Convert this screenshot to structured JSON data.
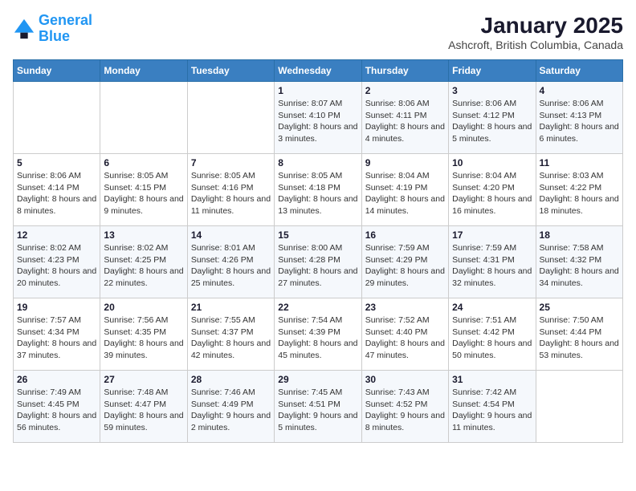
{
  "logo": {
    "line1": "General",
    "line2": "Blue"
  },
  "title": "January 2025",
  "subtitle": "Ashcroft, British Columbia, Canada",
  "days_of_week": [
    "Sunday",
    "Monday",
    "Tuesday",
    "Wednesday",
    "Thursday",
    "Friday",
    "Saturday"
  ],
  "weeks": [
    [
      {
        "num": "",
        "detail": ""
      },
      {
        "num": "",
        "detail": ""
      },
      {
        "num": "",
        "detail": ""
      },
      {
        "num": "1",
        "detail": "Sunrise: 8:07 AM\nSunset: 4:10 PM\nDaylight: 8 hours and 3 minutes."
      },
      {
        "num": "2",
        "detail": "Sunrise: 8:06 AM\nSunset: 4:11 PM\nDaylight: 8 hours and 4 minutes."
      },
      {
        "num": "3",
        "detail": "Sunrise: 8:06 AM\nSunset: 4:12 PM\nDaylight: 8 hours and 5 minutes."
      },
      {
        "num": "4",
        "detail": "Sunrise: 8:06 AM\nSunset: 4:13 PM\nDaylight: 8 hours and 6 minutes."
      }
    ],
    [
      {
        "num": "5",
        "detail": "Sunrise: 8:06 AM\nSunset: 4:14 PM\nDaylight: 8 hours and 8 minutes."
      },
      {
        "num": "6",
        "detail": "Sunrise: 8:05 AM\nSunset: 4:15 PM\nDaylight: 8 hours and 9 minutes."
      },
      {
        "num": "7",
        "detail": "Sunrise: 8:05 AM\nSunset: 4:16 PM\nDaylight: 8 hours and 11 minutes."
      },
      {
        "num": "8",
        "detail": "Sunrise: 8:05 AM\nSunset: 4:18 PM\nDaylight: 8 hours and 13 minutes."
      },
      {
        "num": "9",
        "detail": "Sunrise: 8:04 AM\nSunset: 4:19 PM\nDaylight: 8 hours and 14 minutes."
      },
      {
        "num": "10",
        "detail": "Sunrise: 8:04 AM\nSunset: 4:20 PM\nDaylight: 8 hours and 16 minutes."
      },
      {
        "num": "11",
        "detail": "Sunrise: 8:03 AM\nSunset: 4:22 PM\nDaylight: 8 hours and 18 minutes."
      }
    ],
    [
      {
        "num": "12",
        "detail": "Sunrise: 8:02 AM\nSunset: 4:23 PM\nDaylight: 8 hours and 20 minutes."
      },
      {
        "num": "13",
        "detail": "Sunrise: 8:02 AM\nSunset: 4:25 PM\nDaylight: 8 hours and 22 minutes."
      },
      {
        "num": "14",
        "detail": "Sunrise: 8:01 AM\nSunset: 4:26 PM\nDaylight: 8 hours and 25 minutes."
      },
      {
        "num": "15",
        "detail": "Sunrise: 8:00 AM\nSunset: 4:28 PM\nDaylight: 8 hours and 27 minutes."
      },
      {
        "num": "16",
        "detail": "Sunrise: 7:59 AM\nSunset: 4:29 PM\nDaylight: 8 hours and 29 minutes."
      },
      {
        "num": "17",
        "detail": "Sunrise: 7:59 AM\nSunset: 4:31 PM\nDaylight: 8 hours and 32 minutes."
      },
      {
        "num": "18",
        "detail": "Sunrise: 7:58 AM\nSunset: 4:32 PM\nDaylight: 8 hours and 34 minutes."
      }
    ],
    [
      {
        "num": "19",
        "detail": "Sunrise: 7:57 AM\nSunset: 4:34 PM\nDaylight: 8 hours and 37 minutes."
      },
      {
        "num": "20",
        "detail": "Sunrise: 7:56 AM\nSunset: 4:35 PM\nDaylight: 8 hours and 39 minutes."
      },
      {
        "num": "21",
        "detail": "Sunrise: 7:55 AM\nSunset: 4:37 PM\nDaylight: 8 hours and 42 minutes."
      },
      {
        "num": "22",
        "detail": "Sunrise: 7:54 AM\nSunset: 4:39 PM\nDaylight: 8 hours and 45 minutes."
      },
      {
        "num": "23",
        "detail": "Sunrise: 7:52 AM\nSunset: 4:40 PM\nDaylight: 8 hours and 47 minutes."
      },
      {
        "num": "24",
        "detail": "Sunrise: 7:51 AM\nSunset: 4:42 PM\nDaylight: 8 hours and 50 minutes."
      },
      {
        "num": "25",
        "detail": "Sunrise: 7:50 AM\nSunset: 4:44 PM\nDaylight: 8 hours and 53 minutes."
      }
    ],
    [
      {
        "num": "26",
        "detail": "Sunrise: 7:49 AM\nSunset: 4:45 PM\nDaylight: 8 hours and 56 minutes."
      },
      {
        "num": "27",
        "detail": "Sunrise: 7:48 AM\nSunset: 4:47 PM\nDaylight: 8 hours and 59 minutes."
      },
      {
        "num": "28",
        "detail": "Sunrise: 7:46 AM\nSunset: 4:49 PM\nDaylight: 9 hours and 2 minutes."
      },
      {
        "num": "29",
        "detail": "Sunrise: 7:45 AM\nSunset: 4:51 PM\nDaylight: 9 hours and 5 minutes."
      },
      {
        "num": "30",
        "detail": "Sunrise: 7:43 AM\nSunset: 4:52 PM\nDaylight: 9 hours and 8 minutes."
      },
      {
        "num": "31",
        "detail": "Sunrise: 7:42 AM\nSunset: 4:54 PM\nDaylight: 9 hours and 11 minutes."
      },
      {
        "num": "",
        "detail": ""
      }
    ]
  ]
}
